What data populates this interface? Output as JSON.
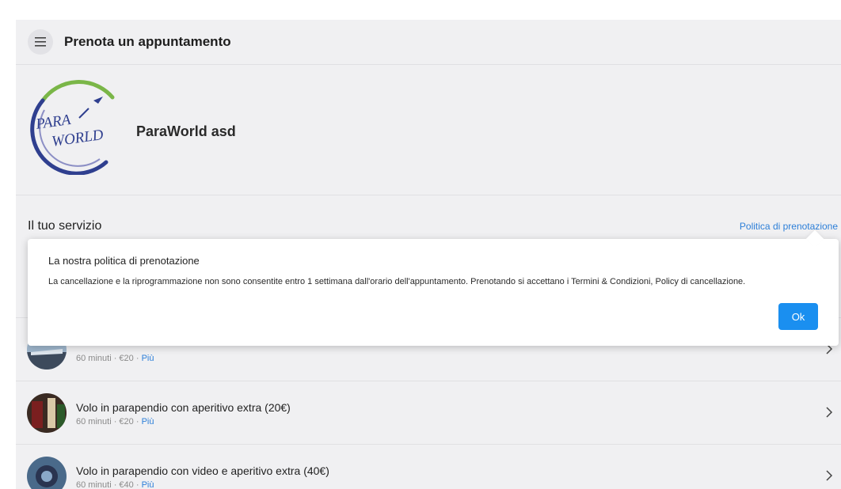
{
  "header": {
    "title": "Prenota un appuntamento"
  },
  "business": {
    "name": "ParaWorld asd",
    "logo_text_top": "PARA",
    "logo_text_bottom": "WORLD"
  },
  "services": {
    "heading": "Il tuo servizio",
    "policy_link": "Politica di prenotazione",
    "items": [
      {
        "name": "",
        "duration": "60 minuti",
        "price": "€20",
        "more": "Più",
        "thumb_icon": "paragliding-photo-icon"
      },
      {
        "name": "Volo in parapendio con aperitivo extra (20€)",
        "duration": "60 minuti",
        "price": "€20",
        "more": "Più",
        "thumb_icon": "aperitivo-photo-icon"
      },
      {
        "name": "Volo in parapendio con video e aperitivo extra (40€)",
        "duration": "60 minuti",
        "price": "€40",
        "more": "Più",
        "thumb_icon": "video-photo-icon"
      }
    ]
  },
  "policy_popup": {
    "title": "La nostra politica di prenotazione",
    "body": "La cancellazione e la riprogrammazione non sono consentite entro 1 settimana dall'orario dell'appuntamento. Prenotando si accettano i Termini & Condizioni, Policy di cancellazione.",
    "ok_label": "Ok"
  },
  "colors": {
    "accent": "#1a8ff0",
    "link": "#2d7fd8",
    "background": "#f0f0f2"
  }
}
